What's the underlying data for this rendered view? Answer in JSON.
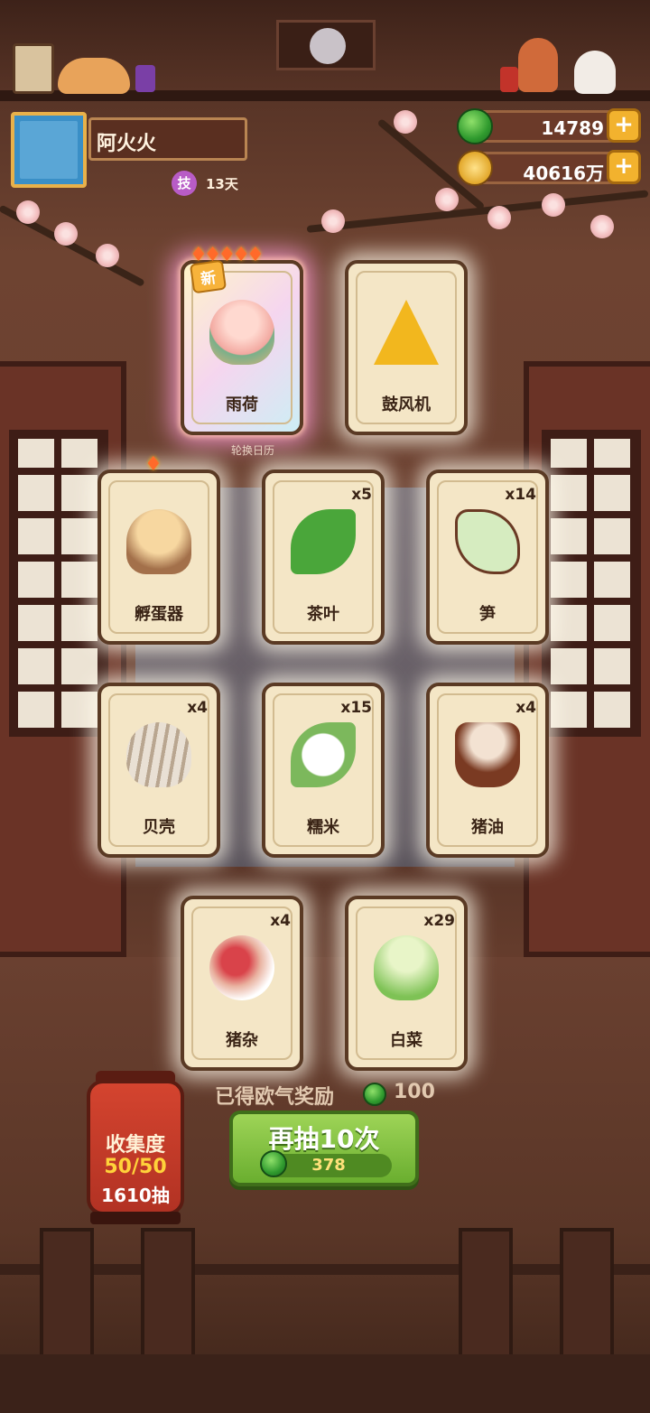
{
  "profile": {
    "name": "阿火火",
    "skill_badge": "技",
    "days": "13天"
  },
  "currency": {
    "jade": "14789",
    "coins": "40616万"
  },
  "cards": [
    {
      "label": "雨荷",
      "count": "",
      "new_tag": "新",
      "rarity_flames": 5,
      "art": "lotus-bowl"
    },
    {
      "label": "鼓风机",
      "count": "",
      "art": "bellows"
    },
    {
      "label": "孵蛋器",
      "count": "",
      "rarity_flames": 1,
      "art": "egg-incubator"
    },
    {
      "label": "茶叶",
      "count": "x5",
      "art": "tea-leaf"
    },
    {
      "label": "笋",
      "count": "x14",
      "art": "bamboo-shoot"
    },
    {
      "label": "贝壳",
      "count": "x4",
      "art": "clam-shell"
    },
    {
      "label": "糯米",
      "count": "x15",
      "art": "sticky-rice"
    },
    {
      "label": "猪油",
      "count": "x4",
      "art": "lard-bowl"
    },
    {
      "label": "猪杂",
      "count": "x4",
      "art": "pork-offal"
    },
    {
      "label": "白菜",
      "count": "x29",
      "art": "napa-cabbage"
    }
  ],
  "calendar_hint": "轮换日历",
  "collection": {
    "title": "收集度",
    "progress": "50/50",
    "draws": "1610抽"
  },
  "luck_reward": {
    "label": "已得欧气奖励",
    "value": "100"
  },
  "draw_button": {
    "label": "再抽10次",
    "cost": "378"
  },
  "colors": {
    "accent_green": "#6aae2f",
    "lantern_red": "#c23a28",
    "card_bg": "#f4e6c6"
  }
}
